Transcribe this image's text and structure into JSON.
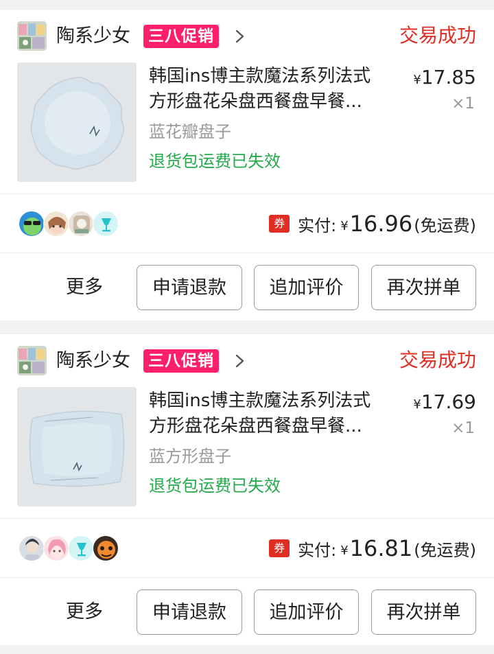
{
  "orders": [
    {
      "shop_name": "陶系少女",
      "promo_badge": "三八促销",
      "status": "交易成功",
      "product": {
        "title_line1": "韩国ins博主款魔法系列法式",
        "title_line2": "方形盘花朵盘西餐盘早餐...",
        "price_symbol": "¥",
        "price": "17.85",
        "quantity": "×1",
        "spec": "蓝花瓣盘子",
        "return_tag": "退货包运费已失效"
      },
      "payment": {
        "coupon_label": "券",
        "paid_label": "实付:",
        "currency": "¥",
        "amount": "16.96",
        "shipping_note": "(免运费)"
      },
      "actions": {
        "more": "更多",
        "refund": "申请退款",
        "review": "追加评价",
        "reorder": "再次拼单"
      }
    },
    {
      "shop_name": "陶系少女",
      "promo_badge": "三八促销",
      "status": "交易成功",
      "product": {
        "title_line1": "韩国ins博主款魔法系列法式",
        "title_line2": "方形盘花朵盘西餐盘早餐...",
        "price_symbol": "¥",
        "price": "17.69",
        "quantity": "×1",
        "spec": "蓝方形盘子",
        "return_tag": "退货包运费已失效"
      },
      "payment": {
        "coupon_label": "券",
        "paid_label": "实付:",
        "currency": "¥",
        "amount": "16.81",
        "shipping_note": "(免运费)"
      },
      "actions": {
        "more": "更多",
        "refund": "申请退款",
        "review": "追加评价",
        "reorder": "再次拼单"
      }
    }
  ],
  "colors": {
    "status_red": "#e02e24",
    "promo_pink": "#ff1f6b",
    "return_green": "#23a94b",
    "page_bg": "#f2f2f2"
  }
}
